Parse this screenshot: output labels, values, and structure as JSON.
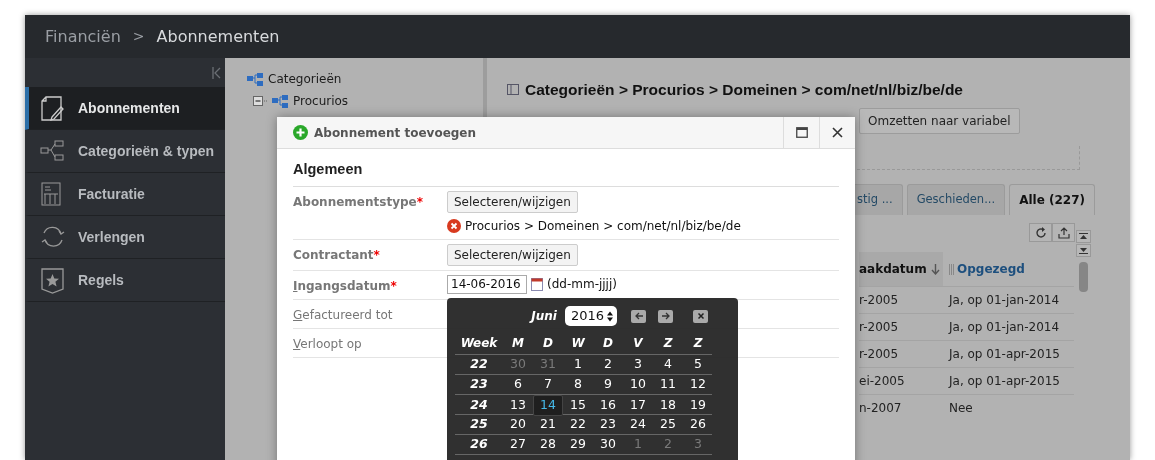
{
  "breadcrumb": {
    "items": [
      "Financiën",
      "Abonnementen"
    ],
    "separator": ">"
  },
  "sidebar": {
    "items": [
      {
        "label": "Abonnementen",
        "selected": true
      },
      {
        "label": "Categorieën & typen",
        "selected": false
      },
      {
        "label": "Facturatie",
        "selected": false
      },
      {
        "label": "Verlengen",
        "selected": false
      },
      {
        "label": "Regels",
        "selected": false
      }
    ]
  },
  "tree": [
    {
      "label": "Categorieën",
      "children": [
        {
          "label": "Procurios",
          "expanded": true
        }
      ]
    }
  ],
  "panel": {
    "title": "Categorieën > Procurios > Domeinen > com/net/nl/biz/be/de",
    "toolbar": [
      "Omzetten naar variabel"
    ],
    "tabs": [
      {
        "label": "stig ...",
        "selected": false
      },
      {
        "label": "Geschieden...",
        "selected": false
      },
      {
        "label": "Alle (227)",
        "selected": true
      }
    ],
    "table": {
      "columns": [
        "aakdatum",
        "Opgezegd"
      ],
      "rows": [
        [
          "r-2005",
          "Ja, op 01-jan-2014"
        ],
        [
          "r-2005",
          "Ja, op 01-jan-2014"
        ],
        [
          "r-2005",
          "Ja, op 01-apr-2015"
        ],
        [
          "ei-2005",
          "Ja, op 01-apr-2015"
        ],
        [
          "n-2007",
          "Nee"
        ]
      ]
    }
  },
  "modal": {
    "title": "Abonnement toevoegen",
    "section": "Algemeen",
    "required_mark": "*",
    "fields": [
      {
        "label": "Abonnementstype",
        "required": true,
        "underline_first": false,
        "kind": "select",
        "button": "Selecteren/wijzigen",
        "value": "Procurios > Domeinen > com/net/nl/biz/be/de",
        "error": true
      },
      {
        "label": "Contractant",
        "required": true,
        "underline_first": false,
        "kind": "select",
        "button": "Selecteren/wijzigen"
      },
      {
        "label": "Ingangsdatum",
        "required": true,
        "underline_first": true,
        "kind": "date",
        "value": "14-06-2016",
        "hint": "(dd-mm-jjjj)"
      },
      {
        "label": "Gefactureerd tot",
        "required": false,
        "underline_first": true,
        "kind": "hidden"
      },
      {
        "label": "Verloopt op",
        "required": false,
        "underline_first": true,
        "kind": "hidden"
      }
    ]
  },
  "calendar": {
    "month": "Juni",
    "year": "2016",
    "headers": [
      "Week",
      "M",
      "D",
      "W",
      "D",
      "V",
      "Z",
      "Z"
    ],
    "weeks": [
      {
        "week": "22",
        "days": [
          {
            "day": "30",
            "outside": true,
            "selected": false
          },
          {
            "day": "31",
            "outside": true,
            "selected": false
          },
          {
            "day": "1",
            "outside": false,
            "selected": false
          },
          {
            "day": "2",
            "outside": false,
            "selected": false
          },
          {
            "day": "3",
            "outside": false,
            "selected": false
          },
          {
            "day": "4",
            "outside": false,
            "selected": false
          },
          {
            "day": "5",
            "outside": false,
            "selected": false
          }
        ]
      },
      {
        "week": "23",
        "days": [
          {
            "day": "6",
            "outside": false,
            "selected": false
          },
          {
            "day": "7",
            "outside": false,
            "selected": false
          },
          {
            "day": "8",
            "outside": false,
            "selected": false
          },
          {
            "day": "9",
            "outside": false,
            "selected": false
          },
          {
            "day": "10",
            "outside": false,
            "selected": false
          },
          {
            "day": "11",
            "outside": false,
            "selected": false
          },
          {
            "day": "12",
            "outside": false,
            "selected": false
          }
        ]
      },
      {
        "week": "24",
        "days": [
          {
            "day": "13",
            "outside": false,
            "selected": false
          },
          {
            "day": "14",
            "outside": false,
            "selected": true
          },
          {
            "day": "15",
            "outside": false,
            "selected": false
          },
          {
            "day": "16",
            "outside": false,
            "selected": false
          },
          {
            "day": "17",
            "outside": false,
            "selected": false
          },
          {
            "day": "18",
            "outside": false,
            "selected": false
          },
          {
            "day": "19",
            "outside": false,
            "selected": false
          }
        ]
      },
      {
        "week": "25",
        "days": [
          {
            "day": "20",
            "outside": false,
            "selected": false
          },
          {
            "day": "21",
            "outside": false,
            "selected": false
          },
          {
            "day": "22",
            "outside": false,
            "selected": false
          },
          {
            "day": "23",
            "outside": false,
            "selected": false
          },
          {
            "day": "24",
            "outside": false,
            "selected": false
          },
          {
            "day": "25",
            "outside": false,
            "selected": false
          },
          {
            "day": "26",
            "outside": false,
            "selected": false
          }
        ]
      },
      {
        "week": "26",
        "days": [
          {
            "day": "27",
            "outside": false,
            "selected": false
          },
          {
            "day": "28",
            "outside": false,
            "selected": false
          },
          {
            "day": "29",
            "outside": false,
            "selected": false
          },
          {
            "day": "30",
            "outside": false,
            "selected": false
          },
          {
            "day": "1",
            "outside": true,
            "selected": false
          },
          {
            "day": "2",
            "outside": true,
            "selected": false
          },
          {
            "day": "3",
            "outside": true,
            "selected": false
          }
        ]
      }
    ]
  }
}
